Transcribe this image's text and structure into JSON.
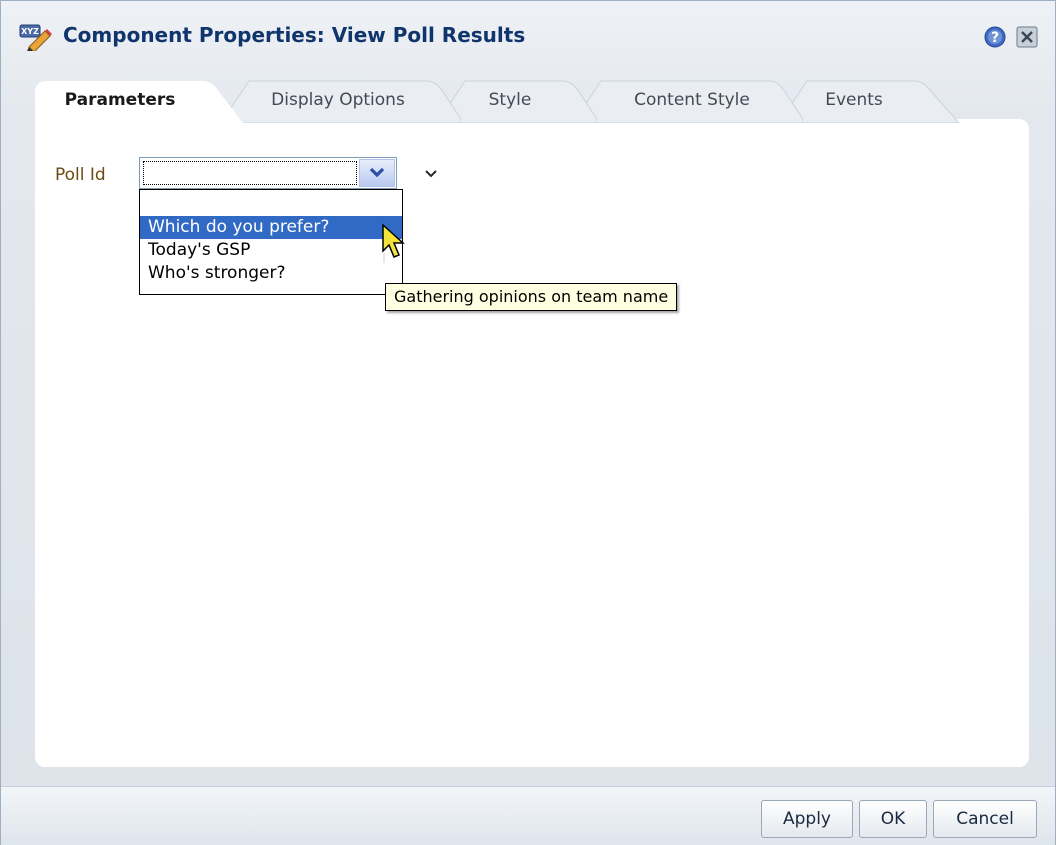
{
  "dialog": {
    "title": "Component Properties: View Poll Results",
    "icon": "xyz-pencil-icon",
    "help_icon": "help-icon",
    "close_icon": "close-icon"
  },
  "tabs": [
    {
      "label": "Parameters",
      "active": true
    },
    {
      "label": "Display Options",
      "active": false
    },
    {
      "label": "Style",
      "active": false
    },
    {
      "label": "Content Style",
      "active": false
    },
    {
      "label": "Events",
      "active": false
    }
  ],
  "form": {
    "poll_id_label": "Poll Id",
    "poll_id_value": "",
    "options": [
      "",
      "Which do you prefer?",
      "Today's GSP",
      "Who's stronger?"
    ],
    "highlighted_option": "Which do you prefer?",
    "tooltip": "Gathering opinions on team name"
  },
  "footer": {
    "apply": "Apply",
    "ok": "OK",
    "cancel": "Cancel"
  },
  "colors": {
    "title": "#10356c",
    "label": "#6b4b12",
    "selection": "#316ac5",
    "tooltip_bg": "#ffffe1"
  }
}
